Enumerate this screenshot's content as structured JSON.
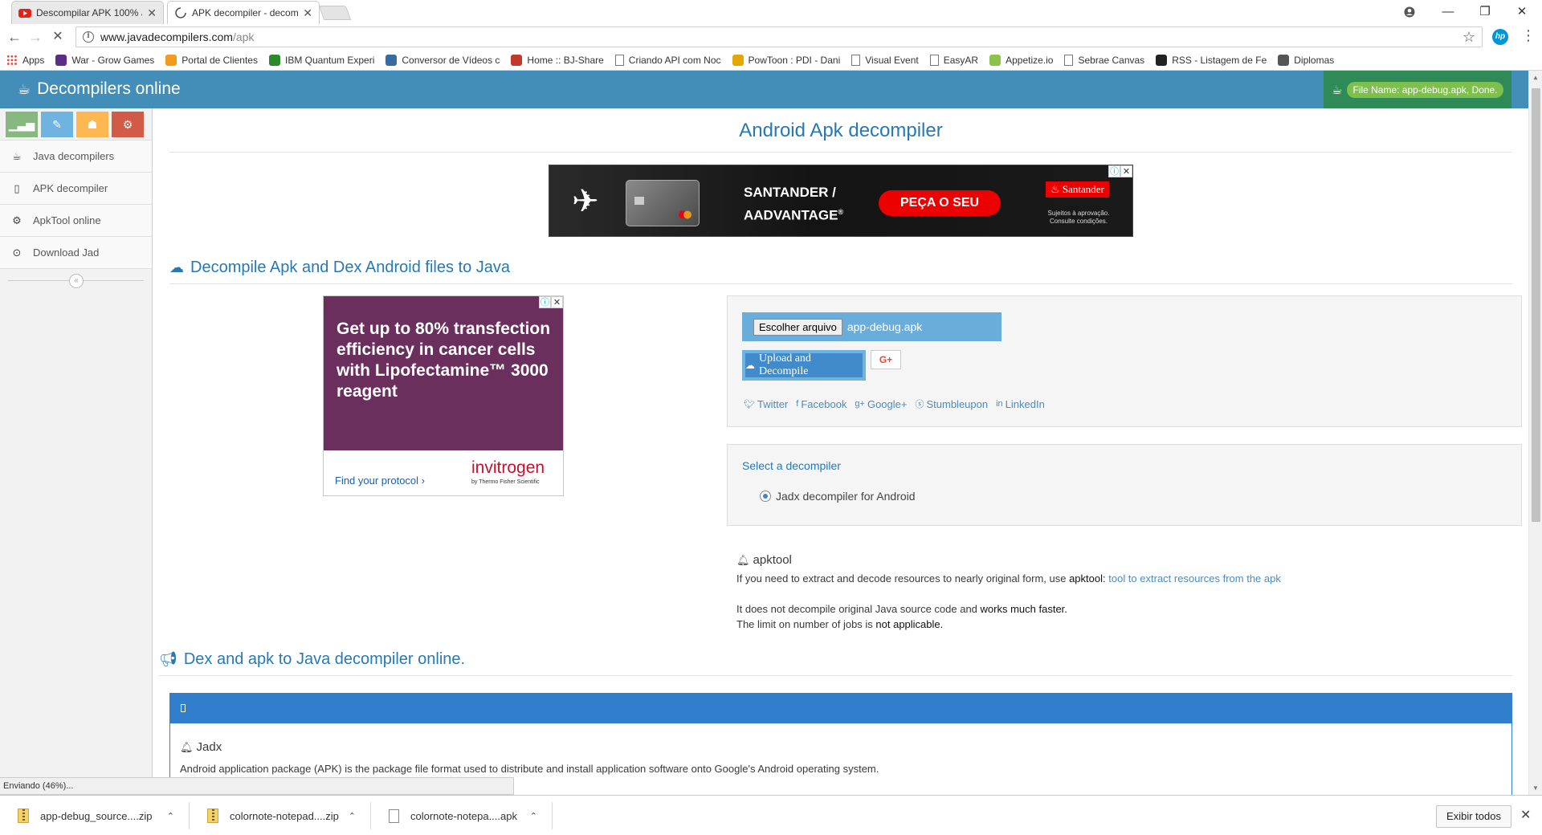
{
  "browser": {
    "tabs": [
      {
        "title": "Descompilar APK 100% J",
        "active": false,
        "icon": "youtube-icon"
      },
      {
        "title": "APK decompiler - decom",
        "active": true,
        "icon": "loading-spinner-icon"
      }
    ],
    "address": {
      "host": "www.javadecompilers.com",
      "path": "/apk"
    },
    "bookmarks": [
      {
        "label": "Apps",
        "icon": "apps-grid-icon",
        "color": "#e84a3b"
      },
      {
        "label": "War - Grow Games",
        "icon": "game-icon",
        "color": "#5b2d86"
      },
      {
        "label": "Portal de Clientes",
        "icon": "portal-icon",
        "color": "#f29b1d"
      },
      {
        "label": "IBM Quantum Experi",
        "icon": "ibm-icon",
        "color": "#2c8a2c"
      },
      {
        "label": "Conversor de Vídeos c",
        "icon": "converter-icon",
        "color": "#3b6aa0"
      },
      {
        "label": "Home :: BJ-Share",
        "icon": "bj-share-icon",
        "color": "#c0392b"
      },
      {
        "label": "Criando API com Noc",
        "icon": "page-icon",
        "color": "#777777"
      },
      {
        "label": "PowToon : PDI - Dani",
        "icon": "powtoon-icon",
        "color": "#e0a800"
      },
      {
        "label": "Visual Event",
        "icon": "page-icon",
        "color": "#777777"
      },
      {
        "label": "EasyAR",
        "icon": "page-icon",
        "color": "#777777"
      },
      {
        "label": "Appetize.io",
        "icon": "appetize-icon",
        "color": "#8bc34a"
      },
      {
        "label": "Sebrae Canvas",
        "icon": "page-icon",
        "color": "#777777"
      },
      {
        "label": "RSS - Listagem de Fe",
        "icon": "rss-icon",
        "color": "#222222"
      },
      {
        "label": "Diplomas",
        "icon": "institution-icon",
        "color": "#555555"
      }
    ]
  },
  "site": {
    "brand": "Decompilers online",
    "file_status": "File Name: app-debug.apk, Done."
  },
  "sidebar": {
    "shortcuts": [
      {
        "name": "stats-shortcut",
        "icon": "signal-icon",
        "glyph": "▁▃▅",
        "color": "#87b87f"
      },
      {
        "name": "edit-shortcut",
        "icon": "pencil-icon",
        "glyph": "✎",
        "color": "#6fb3e0"
      },
      {
        "name": "users-shortcut",
        "icon": "group-icon",
        "glyph": "☗",
        "color": "#ffb752"
      },
      {
        "name": "settings-shortcut",
        "icon": "cogs-icon",
        "glyph": "⚙",
        "color": "#d15b47"
      }
    ],
    "items": [
      {
        "label": "Java decompilers",
        "icon": "coffee-icon"
      },
      {
        "label": "APK decompiler",
        "icon": "mobile-icon"
      },
      {
        "label": "ApkTool online",
        "icon": "cog-icon"
      },
      {
        "label": "Download Jad",
        "icon": "download-icon"
      }
    ]
  },
  "main": {
    "title": "Android Apk decompiler",
    "ad_top": {
      "headline_line1": "SANTANDER /",
      "headline_line2": "AADVANTAGE",
      "cta": "PEÇA O SEU",
      "logo": "Santander",
      "fine_print": "Sujeitos à aprovação. Consulte condições."
    },
    "section_decompile": "Decompile Apk and Dex Android files to Java",
    "ad_side": {
      "copy": "Get up to 80% transfection efficiency in cancer cells with Lipofectamine™ 3000 reagent",
      "link": "Find your protocol ›",
      "brand": "invitrogen",
      "sub_brand": "by Thermo Fisher Scientific"
    },
    "upload": {
      "choose_label": "Escolher arquivo",
      "file_name": "app-debug.apk",
      "button_label": "Upload and Decompile",
      "gplus_label": "G+",
      "shares": [
        "Twitter",
        "Facebook",
        "Google+",
        "Stumbleupon",
        "LinkedIn"
      ]
    },
    "decompiler": {
      "label": "Select a decompiler",
      "option": "Jadx decompiler for Android",
      "selected": true
    },
    "apktool": {
      "heading": "apktool",
      "line1_pre": "If you need to extract and decode resources to nearly original form, use ",
      "line1_bold": "apktool:",
      "line1_link": "tool to extract resources from the apk",
      "line2_pre": "It does not decompile original Java source code and ",
      "line2_bold": "works much faster.",
      "line3_pre": "The limit on number of jobs is ",
      "line3_bold": "not applicable."
    },
    "section_dex": "Dex and apk to Java decompiler online.",
    "widget": {
      "heading": "Jadx",
      "desc": "Android application package (APK) is the package file format used to distribute and install application software onto Google's Android operating system."
    }
  },
  "status_bar": "Enviando (46%)...",
  "downloads": {
    "items": [
      {
        "name": "app-debug_source....zip",
        "type": "zip"
      },
      {
        "name": "colornote-notepad....zip",
        "type": "zip"
      },
      {
        "name": "colornote-notepa....apk",
        "type": "file"
      }
    ],
    "show_all": "Exibir todos"
  },
  "colors": {
    "header": "#438eb9",
    "accent": "#2679b5",
    "widget": "#307ecc",
    "status_green": "#2e8b57"
  }
}
